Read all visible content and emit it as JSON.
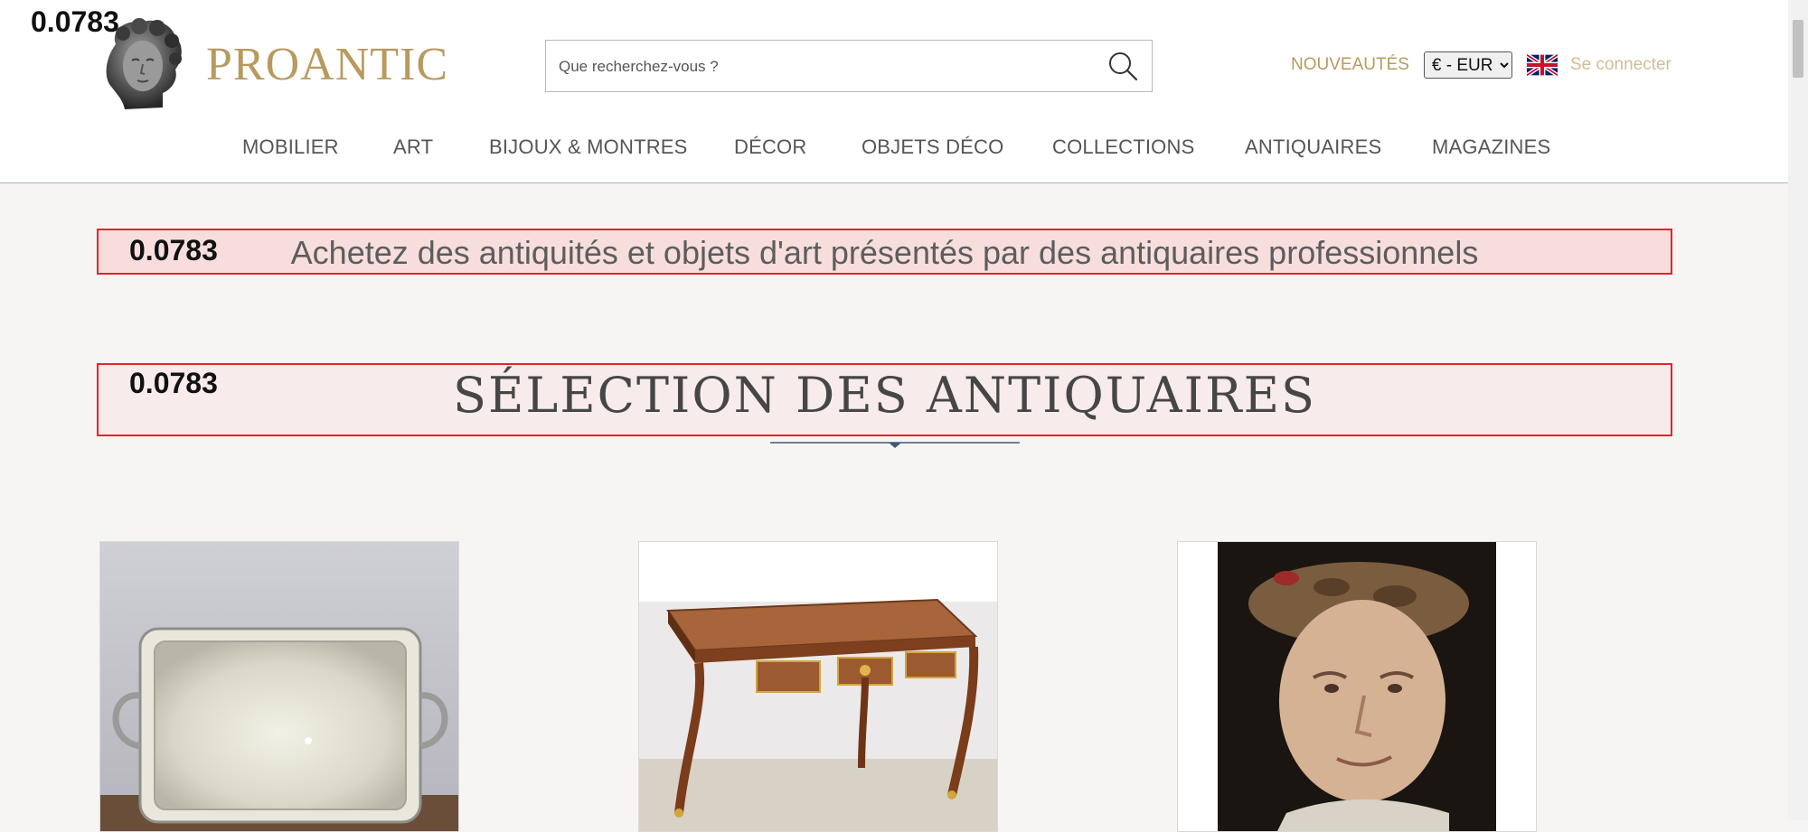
{
  "overlay": {
    "score": "0.0783"
  },
  "header": {
    "logo_text": "PROANTIC",
    "search": {
      "placeholder": "Que recherchez-vous ?",
      "value": ""
    },
    "nouveautes": "NOUVEAUTÉS",
    "currency": {
      "selected": "€ - EUR"
    },
    "language_icon": "uk-flag-icon",
    "login": "Se connecter"
  },
  "nav": {
    "items": [
      {
        "label": "MOBILIER"
      },
      {
        "label": "ART"
      },
      {
        "label": "BIJOUX & MONTRES"
      },
      {
        "label": "DÉCOR"
      },
      {
        "label": "OBJETS DÉCO"
      },
      {
        "label": "COLLECTIONS"
      },
      {
        "label": "ANTIQUAIRES"
      },
      {
        "label": "MAGAZINES"
      }
    ]
  },
  "main": {
    "tagline": "Achetez des antiquités et objets d'art présentés par des antiquaires professionnels",
    "section_title": "SÉLECTION DES ANTIQUAIRES",
    "products": [
      {
        "image": "silver-tray-image"
      },
      {
        "image": "louis-xv-desk-image"
      },
      {
        "image": "portrait-painting-image"
      }
    ]
  },
  "colors": {
    "brand_gold": "#b89a5e",
    "login_gold": "#d2bc93",
    "highlight_border": "#e8212c",
    "page_background": "#f7f5f4"
  }
}
